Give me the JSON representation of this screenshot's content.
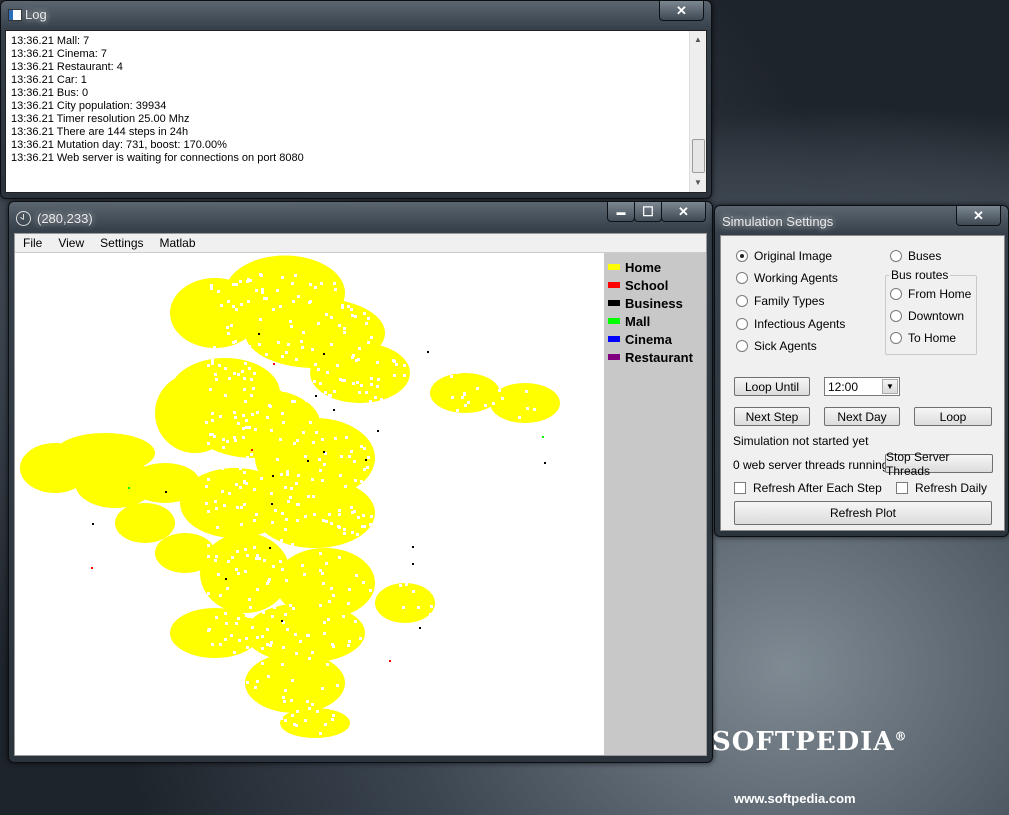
{
  "log_window": {
    "title": "Log",
    "close_label": "✕",
    "lines": [
      "13:36.21 Mall: 7",
      "13:36.21 Cinema: 7",
      "13:36.21 Restaurant: 4",
      "13:36.21 Car: 1",
      "13:36.21 Bus: 0",
      "13:36.21 City population: 39934",
      "13:36.21 Timer resolution 25.00 Mhz",
      "13:36.21 There are 144 steps in 24h",
      "13:36.21 Mutation day: 731, boost: 170.00%",
      "13:36.21 Web server is waiting for connections on port 8080"
    ]
  },
  "map_window": {
    "title": "(280,233)",
    "icon": "clock-icon",
    "min_label": "▬",
    "max_label": "☐",
    "close_label": "✕",
    "menu": [
      "File",
      "View",
      "Settings",
      "Matlab"
    ],
    "legend": [
      {
        "label": "Home",
        "color": "#ffff00"
      },
      {
        "label": "School",
        "color": "#ff0000"
      },
      {
        "label": "Business",
        "color": "#000000"
      },
      {
        "label": "Mall",
        "color": "#00ff00"
      },
      {
        "label": "Cinema",
        "color": "#0000ff"
      },
      {
        "label": "Restaurant",
        "color": "#800080"
      }
    ]
  },
  "settings_window": {
    "title": "Simulation Settings",
    "close_label": "✕",
    "views": [
      {
        "label": "Original Image",
        "selected": true
      },
      {
        "label": "Working Agents",
        "selected": false
      },
      {
        "label": "Family Types",
        "selected": false
      },
      {
        "label": "Infectious Agents",
        "selected": false
      },
      {
        "label": "Sick Agents",
        "selected": false
      }
    ],
    "buses_label": "Buses",
    "bus_routes_label": "Bus routes",
    "bus_routes": [
      "From Home",
      "Downtown",
      "To Home"
    ],
    "loop_until_label": "Loop Until",
    "loop_until_value": "12:00",
    "next_step_label": "Next Step",
    "next_day_label": "Next Day",
    "loop_label": "Loop",
    "status_text": "Simulation not started yet",
    "threads_text": "0 web server threads running.",
    "stop_threads_label": "Stop Server Threads",
    "refresh_each_step_label": "Refresh After Each Step",
    "refresh_daily_label": "Refresh Daily",
    "refresh_plot_label": "Refresh Plot"
  },
  "watermark": {
    "brand": "SOFTPEDIA",
    "reg": "®",
    "url": "www.softpedia.com"
  }
}
